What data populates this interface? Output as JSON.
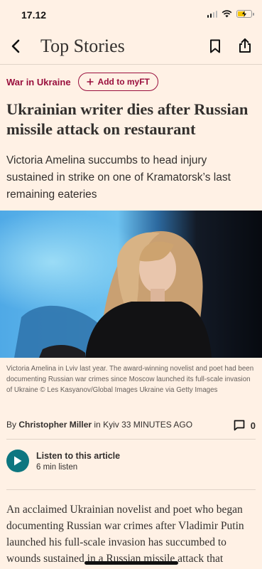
{
  "status_bar": {
    "time": "17.12",
    "battery_level": 0.55,
    "battery_color": "#f5c400",
    "icons": [
      "signal-icon",
      "wifi-icon",
      "battery-charging-icon"
    ]
  },
  "nav": {
    "title": "Top Stories",
    "icons": [
      "back-icon",
      "bookmark-icon",
      "share-icon"
    ]
  },
  "article": {
    "topic_tag": "War in Ukraine",
    "myft_label": "Add to myFT",
    "headline": "Ukrainian writer dies after Russian missile attack on restaurant",
    "standfirst": "Victoria Amelina succumbs to head injury sustained in strike on one of Kramatorsk’s last remaining eateries",
    "caption": "Victoria Amelina in Lviv last year. The award-winning novelist and poet had been documenting Russian war crimes since Moscow launched its full-scale invasion of Ukraine © Les Kasyanov/Global Images Ukraine via Getty Images",
    "byline_prefix": "By",
    "author": "Christopher Miller",
    "location_time": "in Kyiv 33 MINUTES AGO",
    "comment_count": "0",
    "audio_label": "Listen to this article",
    "audio_duration": "6 min listen",
    "body": "An acclaimed Ukrainian novelist and poet who began documenting Russian war crimes after Vladimir Putin launched his full-scale invasion has succumbed to wounds sustained in a Russian missile attack that"
  },
  "colors": {
    "background": "#fff1e5",
    "claret": "#990f3d",
    "teal": "#0d7680",
    "text": "#33302e"
  }
}
